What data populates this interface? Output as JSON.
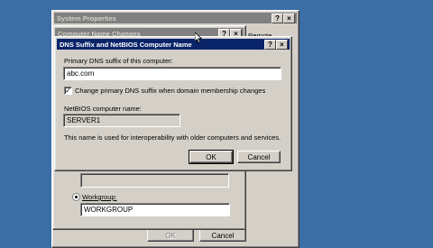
{
  "system_properties": {
    "title": "System Properties",
    "help_btn": "?",
    "close_btn": "×",
    "remote_tab": "Remote",
    "cancel_label": "Cancel",
    "ok_label": "OK"
  },
  "computer_name_changes": {
    "title": "Computer Name Changes",
    "help_btn": "?",
    "close_btn": "×",
    "workgroup_label": "Workgroup:",
    "workgroup_value": "WORKGROUP"
  },
  "dns_dialog": {
    "title": "DNS Suffix and NetBIOS Computer Name",
    "help_btn": "?",
    "close_btn": "×",
    "primary_dns_label": "Primary DNS suffix of this computer:",
    "primary_dns_value": "abc.com",
    "change_checkbox_label": "Change primary DNS suffix when domain membership changes",
    "netbios_label": "NetBIOS computer name:",
    "netbios_value": "SERVER1",
    "info_text": "This name is used for interoperability with older computers and services.",
    "ok_label": "OK",
    "cancel_label": "Cancel"
  }
}
